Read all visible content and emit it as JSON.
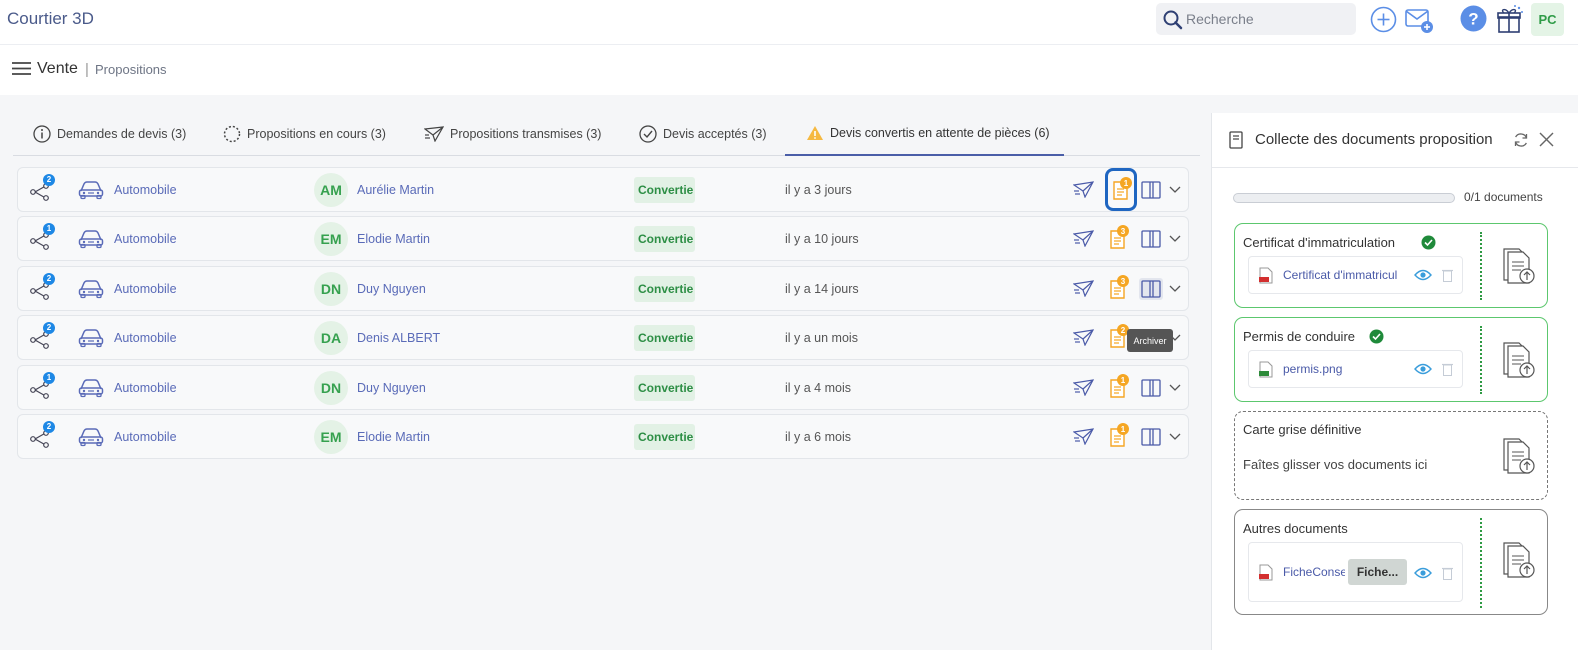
{
  "app": {
    "title": "Courtier 3D"
  },
  "header": {
    "search_placeholder": "Recherche",
    "user_initials": "PC"
  },
  "breadcrumb": {
    "main": "Vente",
    "sep": "|",
    "sub": "Propositions"
  },
  "tabs": [
    {
      "label": "Demandes de devis (3)",
      "icon": "info-icon"
    },
    {
      "label": "Propositions en cours (3)",
      "icon": "spinner-icon"
    },
    {
      "label": "Propositions transmises (3)",
      "icon": "paper-plane-icon"
    },
    {
      "label": "Devis acceptés (3)",
      "icon": "check-circle-icon"
    },
    {
      "label": "Devis convertis en attente de pièces (6)",
      "icon": "warning-icon",
      "active": true
    }
  ],
  "rows": [
    {
      "count": "2",
      "category": "Automobile",
      "initials": "AM",
      "name": "Aurélie Martin",
      "status": "Convertie",
      "date": "il y a 3 jours",
      "docs": "1"
    },
    {
      "count": "1",
      "category": "Automobile",
      "initials": "EM",
      "name": "Elodie Martin",
      "status": "Convertie",
      "date": "il y a 10 jours",
      "docs": "3"
    },
    {
      "count": "2",
      "category": "Automobile",
      "initials": "DN",
      "name": "Duy Nguyen",
      "status": "Convertie",
      "date": "il y a 14 jours",
      "docs": "3"
    },
    {
      "count": "2",
      "category": "Automobile",
      "initials": "DA",
      "name": "Denis ALBERT",
      "status": "Convertie",
      "date": "il y a un mois",
      "docs": "2"
    },
    {
      "count": "1",
      "category": "Automobile",
      "initials": "DN",
      "name": "Duy Nguyen",
      "status": "Convertie",
      "date": "il y a 4 mois",
      "docs": "1"
    },
    {
      "count": "2",
      "category": "Automobile",
      "initials": "EM",
      "name": "Elodie Martin",
      "status": "Convertie",
      "date": "il y a 6 mois",
      "docs": "1"
    }
  ],
  "tooltip": "Archiver",
  "panel": {
    "title": "Collecte des documents proposition",
    "progress_text": "0/1 documents",
    "progress_fraction": 0,
    "cards": [
      {
        "title": "Certificat d'immatriculation",
        "file": "Certificat d'immatricul"
      },
      {
        "title": "Permis de conduire",
        "file": "permis.png"
      },
      {
        "title": "Carte grise définitive",
        "drop": "Faîtes glisser vos documents ici"
      },
      {
        "title": "Autres documents",
        "file": "FicheConse",
        "pill": "Fiche..."
      }
    ]
  },
  "colors": {
    "accent": "#4a5ea8",
    "success": "#2d8e45",
    "badge_blue": "#1e88e5",
    "badge_orange": "#f5a623",
    "focus": "#1f66c1"
  }
}
